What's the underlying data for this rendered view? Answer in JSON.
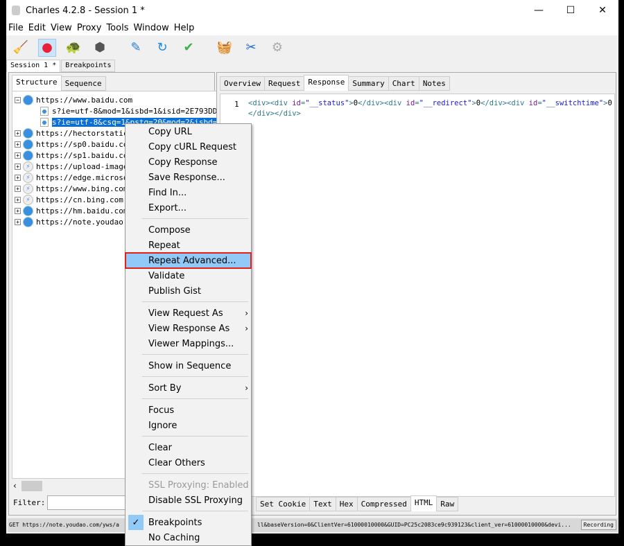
{
  "window": {
    "title": "Charles 4.2.8 - Session 1 *",
    "minimize": "—",
    "maximize": "☐",
    "close": "✕"
  },
  "menubar": [
    "File",
    "Edit",
    "View",
    "Proxy",
    "Tools",
    "Window",
    "Help"
  ],
  "toolbar": [
    {
      "icon": "broom-icon",
      "glyph": "🧹"
    },
    {
      "icon": "record-icon",
      "glyph": "●",
      "active": true
    },
    {
      "icon": "turtle-icon",
      "glyph": "🐢"
    },
    {
      "icon": "stop-icon",
      "glyph": "⬢"
    },
    {
      "icon": "pen-icon",
      "glyph": "✎"
    },
    {
      "icon": "refresh-icon",
      "glyph": "↻"
    },
    {
      "icon": "check-icon",
      "glyph": "✔"
    },
    {
      "icon": "basket-icon",
      "glyph": "🧺"
    },
    {
      "icon": "tools-icon",
      "glyph": "✂"
    },
    {
      "icon": "gear-icon",
      "glyph": "⚙"
    }
  ],
  "session_tabs": [
    "Session 1 *",
    "Breakpoints"
  ],
  "left_tabs": [
    "Structure",
    "Sequence"
  ],
  "tree": [
    {
      "label": "https://www.baidu.com",
      "icon": "globe",
      "expanded": true,
      "children": [
        "s?ie=utf-8&mod=1&isbd=1&isid=2E793DD366E",
        "s?ie=utf-8&csq=1&pstg=20&mod=2&isbd=1&c"
      ]
    },
    {
      "label": "https://hectorstatic.b",
      "icon": "globe"
    },
    {
      "label": "https://sp0.baidu.com",
      "icon": "globe"
    },
    {
      "label": "https://sp1.baidu.com",
      "icon": "globe"
    },
    {
      "label": "https://upload-images.",
      "icon": "bolt"
    },
    {
      "label": "https://edge.microsoft",
      "icon": "bolt"
    },
    {
      "label": "https://www.bing.com",
      "icon": "bolt"
    },
    {
      "label": "https://cn.bing.com",
      "icon": "bolt"
    },
    {
      "label": "https://hm.baidu.com",
      "icon": "globe"
    },
    {
      "label": "https://note.youdao.com",
      "icon": "globe"
    }
  ],
  "filter": {
    "label": "Filter:",
    "value": ""
  },
  "right_tabs": [
    "Overview",
    "Request",
    "Response",
    "Summary",
    "Chart",
    "Notes"
  ],
  "response": {
    "line": "1"
  },
  "bottom_tabs": [
    "Set Cookie",
    "Text",
    "Hex",
    "Compressed",
    "HTML",
    "Raw"
  ],
  "context_menu": [
    [
      "Copy URL",
      "Copy cURL Request",
      "Copy Response",
      "Save Response...",
      "Find In...",
      "Export..."
    ],
    [
      "Compose",
      "Repeat",
      "Repeat Advanced...",
      "Validate",
      "Publish Gist"
    ],
    [
      "View Request As",
      "View Response As",
      "Viewer Mappings..."
    ],
    [
      "Show in Sequence"
    ],
    [
      "Sort By"
    ],
    [
      "Focus",
      "Ignore"
    ],
    [
      "Clear",
      "Clear Others"
    ],
    [
      "SSL Proxying: Enabled",
      "Disable SSL Proxying"
    ],
    [
      "Breakpoints",
      "No Caching"
    ]
  ],
  "menu_highlight": "Repeat Advanced...",
  "menu_submenus": [
    "View Request As",
    "View Response As",
    "Sort By"
  ],
  "menu_disabled": [
    "SSL Proxying: Enabled"
  ],
  "menu_checked": [
    "Breakpoints"
  ],
  "status": {
    "left": "GET https://note.youdao.com/yws/a",
    "right": "ll&baseVersion=0&ClientVer=61000010000&GUID=PC25c2083ce9c939123&client_ver=61000010000&devi...",
    "button": "Recording"
  }
}
